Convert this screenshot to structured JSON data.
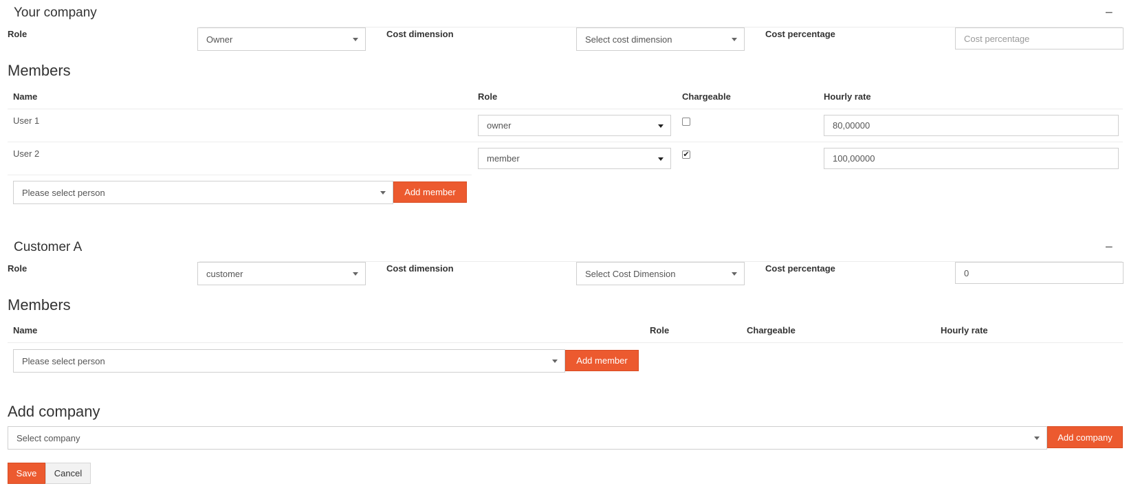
{
  "companies": [
    {
      "title": "Your company",
      "collapse_glyph": "−",
      "role_label": "Role",
      "role_value": "Owner",
      "cost_dimension_label": "Cost dimension",
      "cost_dimension_value": "Select cost dimension",
      "cost_percentage_label": "Cost percentage",
      "cost_percentage_value": "",
      "cost_percentage_placeholder": "Cost percentage",
      "members_heading": "Members",
      "columns": {
        "name": "Name",
        "role": "Role",
        "chargeable": "Chargeable",
        "hourly_rate": "Hourly rate"
      },
      "members": [
        {
          "name": "User 1",
          "role": "owner",
          "chargeable": false,
          "hourly_rate": "80,00000"
        },
        {
          "name": "User 2",
          "role": "member",
          "chargeable": true,
          "hourly_rate": "100,00000"
        }
      ],
      "person_select_placeholder": "Please select person",
      "add_member_label": "Add member"
    },
    {
      "title": "Customer A",
      "collapse_glyph": "−",
      "role_label": "Role",
      "role_value": "customer",
      "cost_dimension_label": "Cost dimension",
      "cost_dimension_value": "Select Cost Dimension",
      "cost_percentage_label": "Cost percentage",
      "cost_percentage_value": "0",
      "cost_percentage_placeholder": "",
      "members_heading": "Members",
      "columns": {
        "name": "Name",
        "role": "Role",
        "chargeable": "Chargeable",
        "hourly_rate": "Hourly rate"
      },
      "members": [],
      "person_select_placeholder": "Please select person",
      "add_member_label": "Add member"
    }
  ],
  "add_company": {
    "heading": "Add company",
    "select_placeholder": "Select company",
    "button_label": "Add company"
  },
  "footer": {
    "save_label": "Save",
    "cancel_label": "Cancel"
  },
  "colors": {
    "accent": "#ec5a2f",
    "border": "#cfcfcf",
    "text": "#333333"
  }
}
